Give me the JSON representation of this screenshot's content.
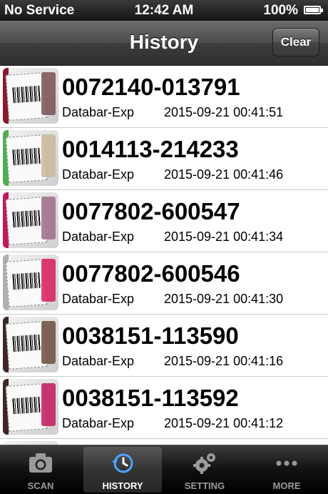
{
  "status_bar": {
    "carrier": "No Service",
    "time": "12:42 AM",
    "battery": "100%",
    "battery_icon": "battery-full-icon"
  },
  "nav": {
    "title": "History",
    "clear_label": "Clear"
  },
  "history": {
    "items": [
      {
        "code": "0072140-013791",
        "type": "Databar-Exp",
        "timestamp": "2015-09-21 00:41:51",
        "accent": "#8b1a2a",
        "product": "#7a5050"
      },
      {
        "code": "0014113-214233",
        "type": "Databar-Exp",
        "timestamp": "2015-09-21 00:41:46",
        "accent": "#4caf50",
        "product": "#c9b79c"
      },
      {
        "code": "0077802-600547",
        "type": "Databar-Exp",
        "timestamp": "2015-09-21 00:41:34",
        "accent": "#c2185b",
        "product": "#9e6b8a"
      },
      {
        "code": "0077802-600546",
        "type": "Databar-Exp",
        "timestamp": "2015-09-21 00:41:30",
        "accent": "#b0b0b0",
        "product": "#d81b60"
      },
      {
        "code": "0038151-113590",
        "type": "Databar-Exp",
        "timestamp": "2015-09-21 00:41:16",
        "accent": "#3e2723",
        "product": "#6d4c41"
      },
      {
        "code": "0038151-113592",
        "type": "Databar-Exp",
        "timestamp": "2015-09-21 00:41:12",
        "accent": "#3e2723",
        "product": "#c2185b"
      }
    ]
  },
  "tabs": [
    {
      "label": "SCAN",
      "icon": "camera-icon"
    },
    {
      "label": "HISTORY",
      "icon": "history-clock-icon"
    },
    {
      "label": "SETTING",
      "icon": "gears-icon"
    },
    {
      "label": "MORE",
      "icon": "more-dots-icon"
    }
  ],
  "colors": {
    "nav_bar": "#4c4c4c",
    "tab_bar": "#111111",
    "tab_selected": "#ffffff",
    "tab_icon_accent": "#4da3ff"
  }
}
